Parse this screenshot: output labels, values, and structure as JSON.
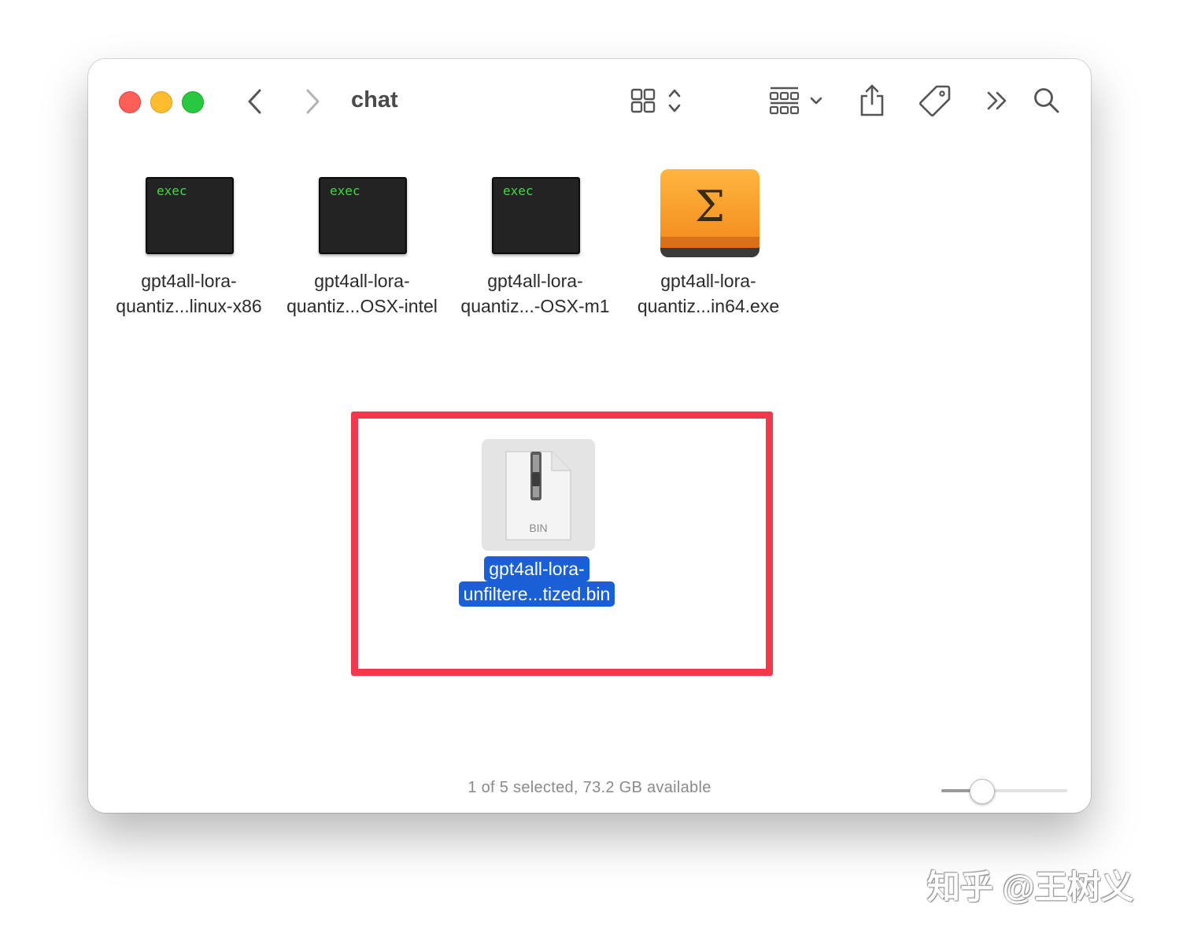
{
  "window": {
    "title": "chat"
  },
  "toolbar": {
    "back_icon": "chevron-left-icon",
    "forward_icon": "chevron-right-icon",
    "view_icon": "icon-grid-view-icon",
    "group_icon": "group-by-icon",
    "share_icon": "share-icon",
    "tag_icon": "tag-icon",
    "more_icon": "double-chevron-icon",
    "search_icon": "search-icon"
  },
  "files": [
    {
      "line1": "gpt4all-lora-",
      "line2": "quantiz...linux-x86",
      "icon": "exec",
      "icon_label": "exec"
    },
    {
      "line1": "gpt4all-lora-",
      "line2": "quantiz...OSX-intel",
      "icon": "exec",
      "icon_label": "exec"
    },
    {
      "line1": "gpt4all-lora-",
      "line2": "quantiz...-OSX-m1",
      "icon": "exec",
      "icon_label": "exec"
    },
    {
      "line1": "gpt4all-lora-",
      "line2": "quantiz...in64.exe",
      "icon": "sigma",
      "icon_label": "Σ"
    }
  ],
  "selected_file": {
    "line1": "gpt4all-lora-",
    "line2": "unfiltere...tized.bin",
    "icon_label": "BIN",
    "selection_color": "#1a5fd6"
  },
  "highlight_color": "#f2384a",
  "status": {
    "text": "1 of 5 selected, 73.2 GB available"
  },
  "zoom_slider": {
    "value": 0.28
  },
  "watermark": {
    "text": "知乎 @王树义"
  }
}
